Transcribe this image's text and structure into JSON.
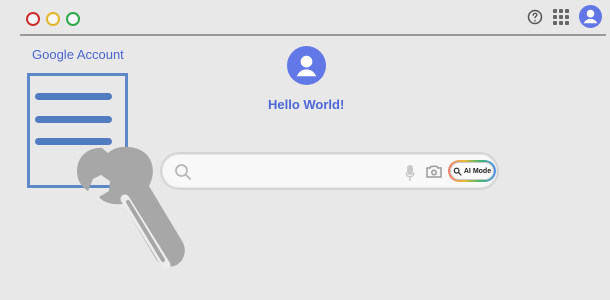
{
  "window": {
    "controls": [
      "close",
      "minimize",
      "maximize"
    ]
  },
  "header": {
    "help_icon": "help-icon",
    "apps_icon": "apps-icon",
    "profile_icon": "profile-avatar-icon"
  },
  "sidebar": {
    "account_label": "Google Account"
  },
  "main": {
    "greeting": "Hello World!",
    "search": {
      "placeholder": "",
      "ai_mode_label": "AI Mode"
    }
  },
  "colors": {
    "background": "#e8e8e8",
    "accent_blue": "#4f68d8",
    "avatar_blue": "#6278e7",
    "sidebar_blue": "#517dc0"
  }
}
